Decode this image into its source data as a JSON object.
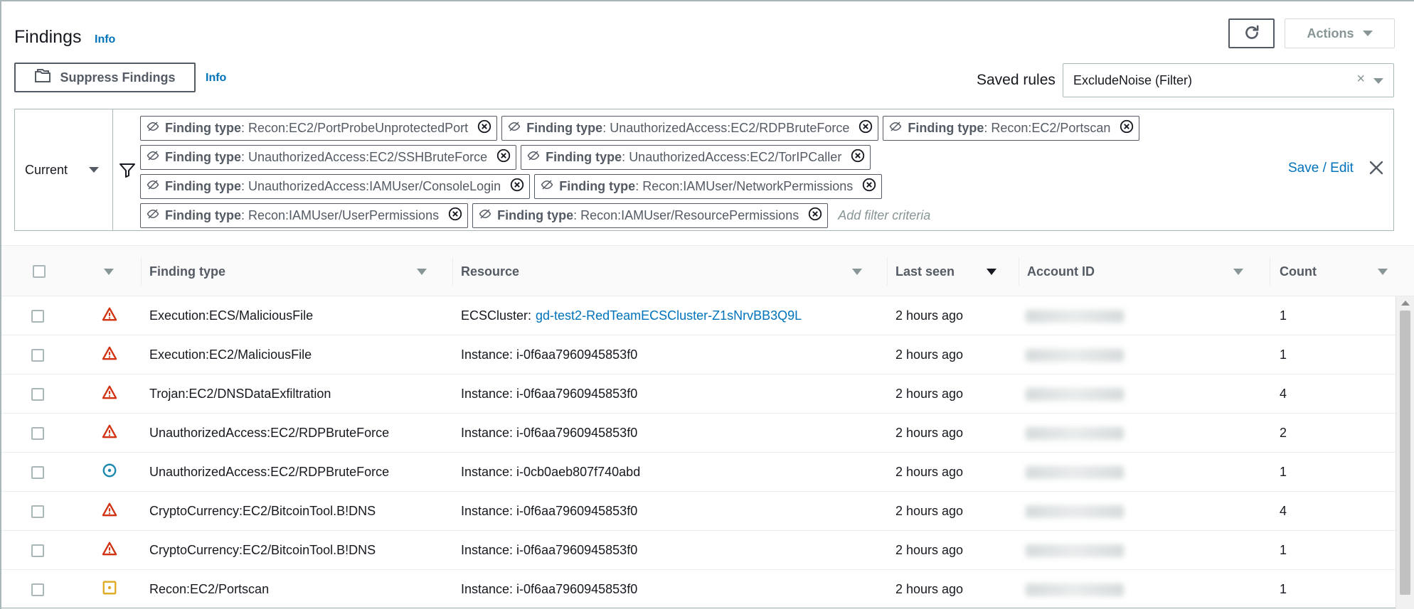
{
  "header": {
    "title": "Findings",
    "info_label": "Info",
    "actions_label": "Actions",
    "refresh_icon": "refresh-icon"
  },
  "toolbar": {
    "suppress_label": "Suppress Findings",
    "info_label": "Info",
    "saved_rules_label": "Saved rules",
    "saved_rules_value": "ExcludeNoise (Filter)",
    "clear_glyph": "×"
  },
  "filter": {
    "mode_label": "Current",
    "save_edit_label": "Save / Edit",
    "add_placeholder": "Add filter criteria",
    "token_key": "Finding type",
    "token_sep": ":",
    "rows": [
      [
        "Recon:EC2/PortProbeUnprotectedPort",
        "UnauthorizedAccess:EC2/RDPBruteForce",
        "Recon:EC2/Portscan"
      ],
      [
        "UnauthorizedAccess:EC2/SSHBruteForce",
        "UnauthorizedAccess:EC2/TorIPCaller"
      ],
      [
        "UnauthorizedAccess:IAMUser/ConsoleLogin",
        "Recon:IAMUser/NetworkPermissions"
      ],
      [
        "Recon:IAMUser/UserPermissions",
        "Recon:IAMUser/ResourcePermissions"
      ]
    ]
  },
  "table": {
    "columns": {
      "finding_type": "Finding type",
      "resource": "Resource",
      "last_seen": "Last seen",
      "account_id": "Account ID",
      "count": "Count"
    },
    "rows": [
      {
        "severity": "high",
        "finding": "Execution:ECS/MaliciousFile",
        "resource_prefix": "ECSCluster:",
        "resource_link": "gd-test2-RedTeamECSCluster-Z1sNrvBB3Q9L",
        "last_seen": "2 hours ago",
        "count": "1"
      },
      {
        "severity": "high",
        "finding": "Execution:EC2/MaliciousFile",
        "resource_prefix": "Instance: i-0f6aa7960945853f0",
        "resource_link": "",
        "last_seen": "2 hours ago",
        "count": "1"
      },
      {
        "severity": "high",
        "finding": "Trojan:EC2/DNSDataExfiltration",
        "resource_prefix": "Instance: i-0f6aa7960945853f0",
        "resource_link": "",
        "last_seen": "2 hours ago",
        "count": "4"
      },
      {
        "severity": "high",
        "finding": "UnauthorizedAccess:EC2/RDPBruteForce",
        "resource_prefix": "Instance: i-0f6aa7960945853f0",
        "resource_link": "",
        "last_seen": "2 hours ago",
        "count": "2"
      },
      {
        "severity": "low",
        "finding": "UnauthorizedAccess:EC2/RDPBruteForce",
        "resource_prefix": "Instance: i-0cb0aeb807f740abd",
        "resource_link": "",
        "last_seen": "2 hours ago",
        "count": "1"
      },
      {
        "severity": "high",
        "finding": "CryptoCurrency:EC2/BitcoinTool.B!DNS",
        "resource_prefix": "Instance: i-0f6aa7960945853f0",
        "resource_link": "",
        "last_seen": "2 hours ago",
        "count": "4"
      },
      {
        "severity": "high",
        "finding": "CryptoCurrency:EC2/BitcoinTool.B!DNS",
        "resource_prefix": "Instance: i-0f6aa7960945853f0",
        "resource_link": "",
        "last_seen": "2 hours ago",
        "count": "1"
      },
      {
        "severity": "medium",
        "finding": "Recon:EC2/Portscan",
        "resource_prefix": "Instance: i-0f6aa7960945853f0",
        "resource_link": "",
        "last_seen": "2 hours ago",
        "count": "1"
      }
    ]
  },
  "colors": {
    "link": "#0073bb",
    "severity_high": "#d13212",
    "severity_medium": "#e0ad2b",
    "severity_low": "#1b8aae"
  }
}
